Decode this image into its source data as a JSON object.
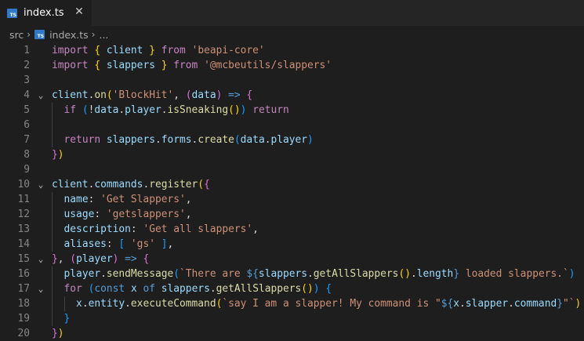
{
  "tab": {
    "icon_text": "TS",
    "label": "index.ts",
    "close_glyph": "✕"
  },
  "breadcrumb": {
    "folder": "src",
    "file": "index.ts",
    "more": "..."
  },
  "editor": {
    "line_numbers": [
      "1",
      "2",
      "3",
      "4",
      "5",
      "6",
      "7",
      "8",
      "9",
      "10",
      "11",
      "12",
      "13",
      "14",
      "15",
      "16",
      "17",
      "18",
      "19",
      "20"
    ],
    "code": {
      "l1": [
        "import",
        " ",
        "{",
        " ",
        "client",
        " ",
        "}",
        " ",
        "from",
        " ",
        "'beapi-core'"
      ],
      "l2": [
        "import",
        " ",
        "{",
        " ",
        "slappers",
        " ",
        "}",
        " ",
        "from",
        " ",
        "'@mcbeutils/slappers'"
      ],
      "l4": [
        "client",
        ".",
        "on",
        "(",
        "'BlockHit'",
        ", ",
        "(",
        "data",
        ")",
        " ",
        "=>",
        " ",
        "{"
      ],
      "l5": [
        "if",
        " ",
        "(",
        "!",
        "data",
        ".",
        "player",
        ".",
        "isSneaking",
        "()",
        ")",
        " ",
        "return"
      ],
      "l7": [
        "return",
        " ",
        "slappers",
        ".",
        "forms",
        ".",
        "create",
        "(",
        "data",
        ".",
        "player",
        ")"
      ],
      "l8": [
        "}",
        ")"
      ],
      "l10": [
        "client",
        ".",
        "commands",
        ".",
        "register",
        "(",
        "{"
      ],
      "l11": [
        "name",
        ": ",
        "'Get Slappers'",
        ","
      ],
      "l12": [
        "usage",
        ": ",
        "'getslappers'",
        ","
      ],
      "l13": [
        "description",
        ": ",
        "'Get all slappers'",
        ","
      ],
      "l14": [
        "aliases",
        ": ",
        "[",
        " ",
        "'gs'",
        " ",
        "]",
        ","
      ],
      "l15": [
        "}",
        ", ",
        "(",
        "player",
        ")",
        " ",
        "=>",
        " ",
        "{"
      ],
      "l16": [
        "player",
        ".",
        "sendMessage",
        "(",
        "`There are ",
        "${",
        "slappers",
        ".",
        "getAllSlappers",
        "()",
        ".",
        "length",
        "}",
        " loaded slappers.`",
        ")"
      ],
      "l17": [
        "for",
        " ",
        "(",
        "const",
        " ",
        "x",
        " ",
        "of",
        " ",
        "slappers",
        ".",
        "getAllSlappers",
        "()",
        ")",
        " ",
        "{"
      ],
      "l18": [
        "x",
        ".",
        "entity",
        ".",
        "executeCommand",
        "(",
        "`say I am a slapper! My command is \"",
        "${",
        "x",
        ".",
        "slapper",
        ".",
        "command",
        "}",
        "\"`",
        ")"
      ],
      "l19": [
        "}"
      ],
      "l20": [
        "}",
        ")"
      ]
    },
    "fold_glyph": "⌄"
  }
}
